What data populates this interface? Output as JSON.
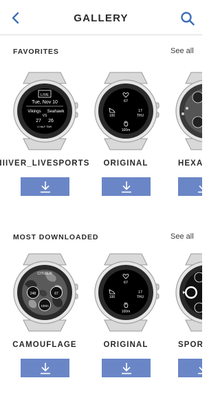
{
  "header": {
    "title": "GALLERY",
    "back_icon": "chevron-left-icon",
    "search_icon": "search-icon",
    "accent_color": "#3f6fb8"
  },
  "favorites": {
    "title": "FAVORITES",
    "see_all": "See all",
    "items": [
      {
        "name": "RIIIVER_LIVESPORTS",
        "face": {
          "badge": "LIVE",
          "date": "Tue, Nov 10",
          "team_home": "Vikings",
          "team_away": "Seahawk",
          "vs": "VS",
          "score_home": "27",
          "score_away": "26",
          "footer": "4 HALF TIME"
        }
      },
      {
        "name": "ORIGINAL",
        "face": {
          "top": "67",
          "left": "100",
          "right_top": "17",
          "right_bottom": "THU",
          "bottom": "100m"
        }
      },
      {
        "name": "HEXAGON"
      }
    ]
  },
  "most_downloaded": {
    "title": "MOST DOWNLOADED",
    "see_all": "See all",
    "items": [
      {
        "name": "CAMOUFLAGE",
        "face": {
          "brand": "CITIZEN",
          "left": "248",
          "right": "67",
          "bottom": "100m"
        }
      },
      {
        "name": "ORIGINAL",
        "face": {
          "top": "67",
          "left": "100",
          "right_top": "17",
          "right_bottom": "THU",
          "bottom": "100m"
        }
      },
      {
        "name": "SPORT"
      }
    ]
  },
  "download_icon": "download-icon",
  "button_color": "#6a86c6"
}
